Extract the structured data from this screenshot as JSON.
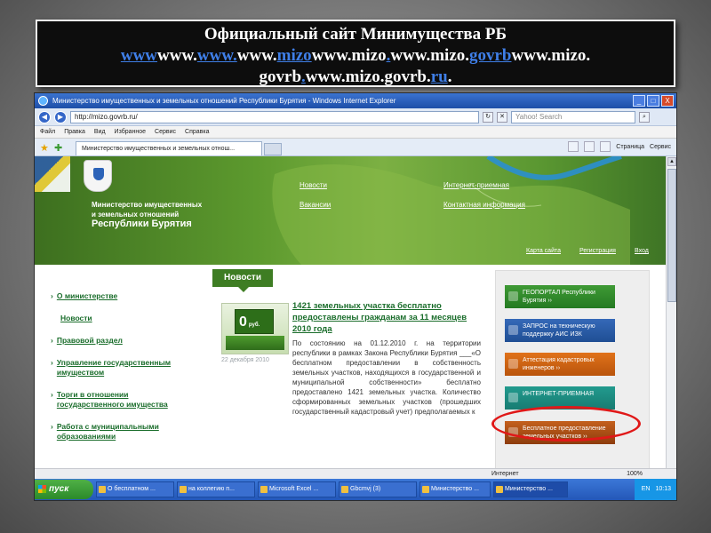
{
  "slide": {
    "title_line1": "Официальный сайт Минимущества РБ",
    "url_parts": [
      "www",
      "www.",
      "www.",
      "mizo",
      "www.mizo",
      ".",
      "www.mizo.",
      "govrb",
      "www.mizo."
    ],
    "url_line2_parts": [
      "govrb",
      ".",
      "www.mizo.govrb.",
      "ru",
      "."
    ]
  },
  "window": {
    "title": "Министерство имущественных и земельных отношений Республики Бурятия - Windows Internet Explorer",
    "minimize": "_",
    "maximize": "□",
    "close": "X"
  },
  "address": {
    "url": "http://mizo.govrb.ru/",
    "search_placeholder": "Yahoo! Search",
    "back": "◀",
    "forward": "▶"
  },
  "menu": [
    "Файл",
    "Правка",
    "Вид",
    "Избранное",
    "Сервис",
    "Справка"
  ],
  "tab": {
    "label": "Министерство имущественных и земельных отнош...",
    "page_label": "Страница",
    "tools_label": "Сервис"
  },
  "banner": {
    "ministry_line1": "Министерство имущественных",
    "ministry_line2": "и земельных отношений",
    "republic": "Республики Бурятия",
    "links": [
      "Новости",
      "Интернет-приемная",
      "Вакансии",
      "Контактная информация"
    ],
    "bottom_links": [
      "Карта сайта",
      "Регистрация",
      "Вход"
    ]
  },
  "left_menu": [
    {
      "label": "О министерстве",
      "arrow": true
    },
    {
      "label": "Новости",
      "arrow": false
    },
    {
      "label": "Правовой раздел",
      "arrow": true
    },
    {
      "label": "Управление государственным имуществом",
      "arrow": true
    },
    {
      "label": "Торги в отношении государственного имущества",
      "arrow": true
    },
    {
      "label": "Работа с муниципальными образованиями",
      "arrow": true
    }
  ],
  "news": {
    "heading": "Новости",
    "thumb_value": "0",
    "thumb_unit": "руб.",
    "date": "22 декабря 2010",
    "title": "1421 земельных участка бесплатно предоставлены гражданам за 11 месяцев 2010 года",
    "body": "По состоянию на 01.12.2010 г. на территории республики в рамках Закона Республики Бурятия ___«О бесплатном предоставлении в собственность земельных участков, находящихся в государственной и муниципальной собственности» бесплатно предоставлено 1421 земельных участка. Количество сформированных земельных участков (прошедших государственный кадастровый учет) предполагаемых к"
  },
  "right_buttons": [
    {
      "label": "ГЕОПОРТАЛ Республики Бурятия ››",
      "color": "green"
    },
    {
      "label": "ЗАПРОС на техническую поддержку АИС ИЗК",
      "color": "blue"
    },
    {
      "label": "Аттестация кадастровых инженеров ››",
      "color": "orange"
    },
    {
      "label": "ИНТЕРНЕТ-ПРИЕМНАЯ",
      "color": "teal"
    },
    {
      "label": "Бесплатное предоставление земельных участков ››",
      "color": "brown"
    }
  ],
  "status": {
    "zone": "Интернет",
    "zoom": "100%"
  },
  "taskbar": {
    "start": "пуск",
    "tasks": [
      "О бесплатном ...",
      "на коллегию п...",
      "Microsoft Excel ...",
      "Gbcmvj (3)",
      "Министерство ...",
      "Министерство ..."
    ],
    "lang": "EN",
    "time": "10:13"
  },
  "colors": {
    "site_green": "#3e7d23",
    "link_green": "#1a6d2b",
    "highlight_red": "#e01818",
    "title_link_blue": "#3f7fe8"
  }
}
